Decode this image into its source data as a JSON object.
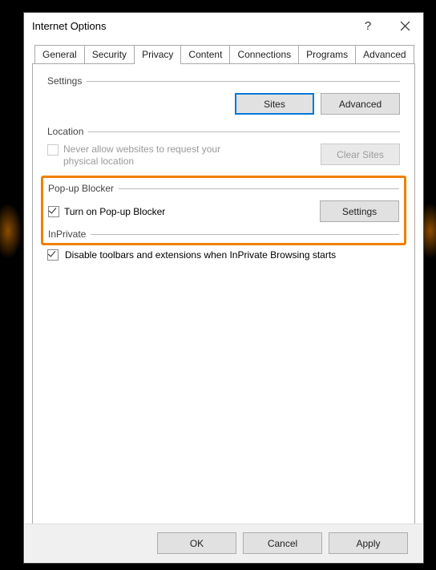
{
  "title": "Internet Options",
  "tabs": [
    "General",
    "Security",
    "Privacy",
    "Content",
    "Connections",
    "Programs",
    "Advanced"
  ],
  "activeTabIndex": 2,
  "settings_group": "Settings",
  "sites_btn": "Sites",
  "advanced_btn": "Advanced",
  "location_group": "Location",
  "location_chk_label": "Never allow websites to request your physical location",
  "clear_sites_btn": "Clear Sites",
  "popup_group": "Pop-up Blocker",
  "popup_chk_label": "Turn on Pop-up Blocker",
  "popup_settings_btn": "Settings",
  "inprivate_group": "InPrivate",
  "inprivate_chk_label": "Disable toolbars and extensions when InPrivate Browsing starts",
  "ok_btn": "OK",
  "cancel_btn": "Cancel",
  "apply_btn": "Apply"
}
